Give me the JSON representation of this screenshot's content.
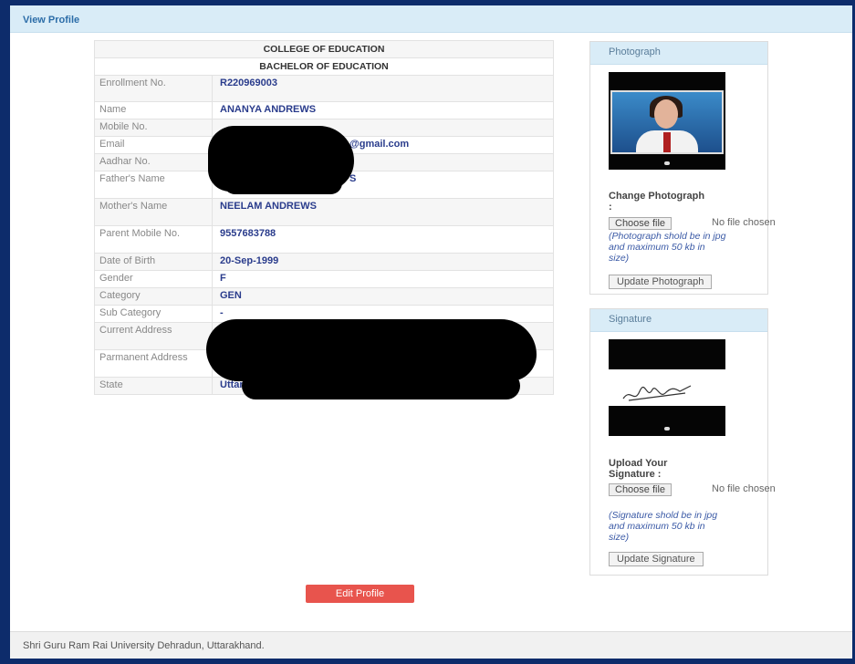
{
  "header": {
    "title": "View Profile"
  },
  "profile": {
    "college": "COLLEGE OF EDUCATION",
    "course": "BACHELOR OF EDUCATION",
    "rows": [
      {
        "label": "Enrollment No.",
        "value": "R220969003"
      },
      {
        "label": "Name",
        "value": "ANANYA ANDREWS"
      },
      {
        "label": "Mobile No.",
        "value": ""
      },
      {
        "label": "Email",
        "value": "@gmail.com"
      },
      {
        "label": "Aadhar No.",
        "value": ""
      },
      {
        "label": "Father's Name",
        "value": "S"
      },
      {
        "label": "Mother's Name",
        "value": "NEELAM ANDREWS"
      },
      {
        "label": "Parent Mobile No.",
        "value": "9557683788"
      },
      {
        "label": "Date of Birth",
        "value": "20-Sep-1999"
      },
      {
        "label": "Gender",
        "value": "F"
      },
      {
        "label": "Category",
        "value": "GEN"
      },
      {
        "label": "Sub Category",
        "value": "-"
      },
      {
        "label": "Current Address",
        "value": ""
      },
      {
        "label": "Parmanent Address",
        "value": ""
      },
      {
        "label": "State",
        "value": "Uttarakhand"
      }
    ]
  },
  "photograph_panel": {
    "title": "Photograph",
    "change_label": "Change Photograph :",
    "choose_file": "Choose file",
    "no_file": "No file chosen",
    "hint": "(Photograph shold be in jpg and maximum 50 kb in size)",
    "update_button": "Update Photograph"
  },
  "signature_panel": {
    "title": "Signature",
    "upload_label": "Upload Your Signature :",
    "choose_file": "Choose file",
    "no_file": "No file chosen",
    "hint": "(Signature shold be in jpg and maximum 50 kb in size)",
    "update_button": "Update Signature"
  },
  "edit_button": "Edit Profile",
  "footer": {
    "text": "Shri Guru Ram Rai University Dehradun, Uttarakhand."
  },
  "colors": {
    "frame": "#0d2c6b",
    "header_bg": "#d9ecf7",
    "value_text": "#2a3c8c",
    "edit_button": "#e8544d"
  }
}
